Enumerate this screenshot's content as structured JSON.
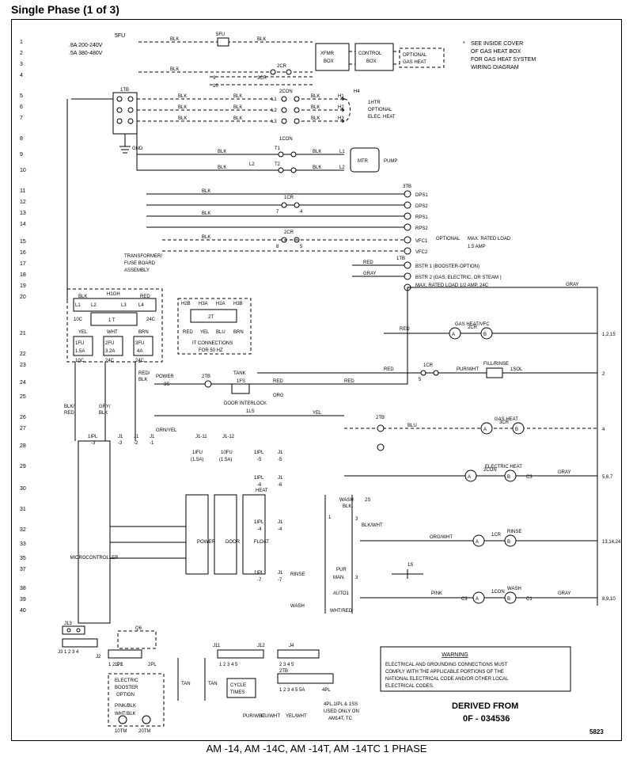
{
  "title": "Single Phase (1 of 3)",
  "caption": "AM -14, AM -14C, AM -14T, AM -14TC 1 PHASE",
  "drawing_number": "5823",
  "derived_from": {
    "line1": "DERIVED FROM",
    "line2": "0F - 034536"
  },
  "note": {
    "prefix": "*",
    "l1": "SEE INSIDE COVER",
    "l2": "OF GAS HEAT BOX",
    "l3": "FOR GAS HEAT SYSTEM",
    "l4": "WIRING DIAGRAM"
  },
  "warning": {
    "title": "WARNING",
    "l1": "ELECTRICAL AND GROUNDING CONNECTIONS MUST",
    "l2": "COMPLY WITH THE APPLICABLE PORTIONS OF THE",
    "l3": "NATIONAL ELECTRICAL CODE AND/OR OTHER LOCAL",
    "l4": "ELECTRICAL CODES."
  },
  "fuse_block": {
    "l1": "5FU",
    "l2": ".8A 200-240V",
    "l3": ".5A 380-480V"
  },
  "left_rows": [
    "1",
    "2",
    "3",
    "4",
    "5",
    "6",
    "7",
    "8",
    "9",
    "10",
    "11",
    "12",
    "13",
    "14",
    "15",
    "16",
    "17",
    "18",
    "19",
    "20",
    "21",
    "22",
    "23",
    "24",
    "25",
    "26",
    "27",
    "28",
    "29",
    "30",
    "31",
    "32",
    "33",
    "35",
    "37",
    "38",
    "39",
    "40"
  ],
  "right_refs": [
    "1,2,15",
    "5,6,7",
    "13,14,24",
    "8,9,10"
  ],
  "xfmr_box": "XFMR\nBOX",
  "control_box": "CONTROL\nBOX",
  "optional_gas": "OPTIONAL\nGAS HEAT",
  "tb_block": "1TB",
  "gnd": "GND",
  "htr_labels": {
    "con": "2CON",
    "h1": "H1",
    "h2": "H2",
    "h3": "H3",
    "h4": "H4"
  },
  "htr_text": {
    "l1": "1HTR",
    "l2": "OPTIONAL",
    "l3": "ELEC. HEAT"
  },
  "icon_block": "1CON",
  "t1": "T1",
  "t2": "T2",
  "pump": {
    "l1": "L1",
    "l2": "L2",
    "mtr": "MTR",
    "label": "PUMP"
  },
  "tb3": "3TB",
  "tb3_rows": [
    "DPS1",
    "DPS2",
    "RPS1",
    "RPS2"
  ],
  "vfc": {
    "l1": "VFC1",
    "l2": "VFC2",
    "opt": "OPTIONAL",
    "rated": "MAX. RATED LOAD",
    "amp": "1.5 AMP"
  },
  "bstr1": "BSTR 1 (BOOSTER-OPTION)",
  "bstr2": "BSTR 2 (GAS, ELECTRIC, OR STEAM )",
  "bstr2b": "MAX. RATED LOAD 1/2 AMP, 24C",
  "itb": "1TB",
  "transformer_panel": {
    "title": "TRANSFORMER/\nFUSE BOARD\nASSEMBLY",
    "h_row": "H1GH",
    "h_colors": [
      "BLK",
      "RED"
    ],
    "l_labels": [
      "L1",
      "L2",
      "L3",
      "L4"
    ],
    "pri_box": "1 T",
    "sec_labels": [
      "10C",
      "24C"
    ],
    "fuses": [
      {
        "name": "1FU",
        "rating": "1.5A"
      },
      {
        "name": "2FU",
        "rating": "3.2A"
      },
      {
        "name": "3FU",
        "rating": "4A"
      }
    ],
    "sec_colors": [
      "YEL",
      "WHT",
      "BRN"
    ],
    "sec_caps": [
      "10C",
      "24C",
      "24C"
    ]
  },
  "it_panel": {
    "h_labels": [
      "H2B",
      "H3A",
      "H2A",
      "H3B"
    ],
    "sec_labels": [
      "RED",
      "YEL",
      "BLU",
      "BRN"
    ],
    "title": "2T",
    "note1": "IT CONNECTIONS",
    "note2": "FOR 50 HZ"
  },
  "colors": {
    "blk": "BLK",
    "red": "RED",
    "gray": "GRAY",
    "org": "ORG",
    "yel": "YEL",
    "tan": "TAN",
    "pink": "PINK",
    "wht": "WHT",
    "blu": "BLU",
    "grn_yel": "GRN/YEL",
    "red_blk": "RED/\nBLK",
    "blk_red": "BLK/\nRED",
    "gry_blk": "GRY/\nBLK",
    "pur_wht": "PUR/WHT",
    "org_wht": "ORG/WHT",
    "blu_wht": "BLU/WHT",
    "yel_wht": "YEL/WHT",
    "pink_blk": "PINK/BLK",
    "wht_blk": "WHT/BLK",
    "wht_red": "WHT/RED",
    "blk_wht": "BLK/WHT"
  },
  "gas_heat": {
    "title": "GAS HEAT/VFC",
    "a": "A",
    "b": "B",
    "relay": "2CR"
  },
  "fill_rinse": {
    "title": "FILL/RINSE",
    "a": "A",
    "b": "B",
    "relay": "1CR",
    "label": "1SOL",
    "switch": "5"
  },
  "gas_heat2": {
    "title": "GAS HEAT",
    "a": "A",
    "b": "B",
    "relay": "3CR"
  },
  "elec_heat": {
    "title": "ELECTRIC HEAT",
    "a": "A",
    "b": "B",
    "relay": "C3",
    "label": "2CON"
  },
  "rinse": {
    "title": "RINSE",
    "a": "A",
    "b": "B",
    "relay": "1CR",
    "label": "1CR"
  },
  "wash": {
    "title": "WASH",
    "a": "A",
    "b": "B",
    "relay": "C3",
    "label": "1CON",
    "c1": "C1"
  },
  "tank_sensor": {
    "label": "TANK\n1FS",
    "col": "RED"
  },
  "door_ils": {
    "label": "DOOR INTERLOCK\n1LS",
    "col": "ORG",
    "col2": "YEL"
  },
  "power_3s": {
    "label": "POWER\n3S",
    "col1": "RED",
    "col2": "2TB"
  },
  "tb2": "2TB",
  "fu5": "5FU",
  "cr2": "2CR",
  "fu9": "9",
  "fu10": "10",
  "icr": "1CR",
  "five": "5",
  "icr7": "7",
  "icr8": "8",
  "cr2_8": "8",
  "mc": {
    "label": "MICROCONTROLLER",
    "ipl": [
      "1IPL\n-3",
      "1IPL\n-2",
      "1IPL\n-1"
    ],
    "j1": [
      "J1\n-3",
      "J1\n-2",
      "J1\n-1"
    ],
    "j1top": [
      "J1-11",
      "J1-12"
    ],
    "iifu": "1IFU\n(1.5A)",
    "iofu": "10FU\n(1.5A)",
    "ipl5": "1IPL\n-5",
    "j15": "J1\n-5",
    "j16": "J1\n-6",
    "ipl6": "1IPL\n-6",
    "j17": "J1\n-7",
    "ipl7": "1IPL\n-7",
    "heat": "HEAT",
    "j14": "J1\n-4",
    "ipl4": "1IPL\n-4"
  },
  "lamp_boxes": [
    "POWER",
    "DOOR",
    "FLOAT"
  ],
  "rinse_lbl": "RINSE",
  "wash_lbl": "WASH",
  "bottom_jacks": {
    "j13": "J13",
    "j3": "1 2 3 4",
    "j2": "J2",
    "j2pins": "1 2 1 2",
    "pl2": "2PL",
    "ipl3": "1PL",
    "j11": "J11",
    "j11pins": "1 2 3 4 5",
    "j4top": "J4",
    "j4pins": "2 3 4 5",
    "j12": "J12"
  },
  "q6": "Q6",
  "booster_opt": {
    "l1": "ELECTRIC",
    "l2": "BOOSTER",
    "l3": "OPTION"
  },
  "cycle_times": "CYCLE\nTIMES",
  "tm_labels": {
    "tm1": "10TM",
    "tm2": "20TM"
  },
  "j4_note": {
    "l1": "4PL,1IPL & 1SS",
    "l2": "USED ONLY ON",
    "l3": "AM14T, TC"
  },
  "tb2_row": [
    "1",
    "2",
    "3",
    "4",
    "5",
    "5A",
    "4PL"
  ],
  "wash_seq": [
    "WASH\nBLK",
    "2S",
    "1S",
    "PUR\nMAN.",
    "AUTO1"
  ],
  "ipl_seq": [
    "3",
    "1",
    "2",
    "3"
  ]
}
